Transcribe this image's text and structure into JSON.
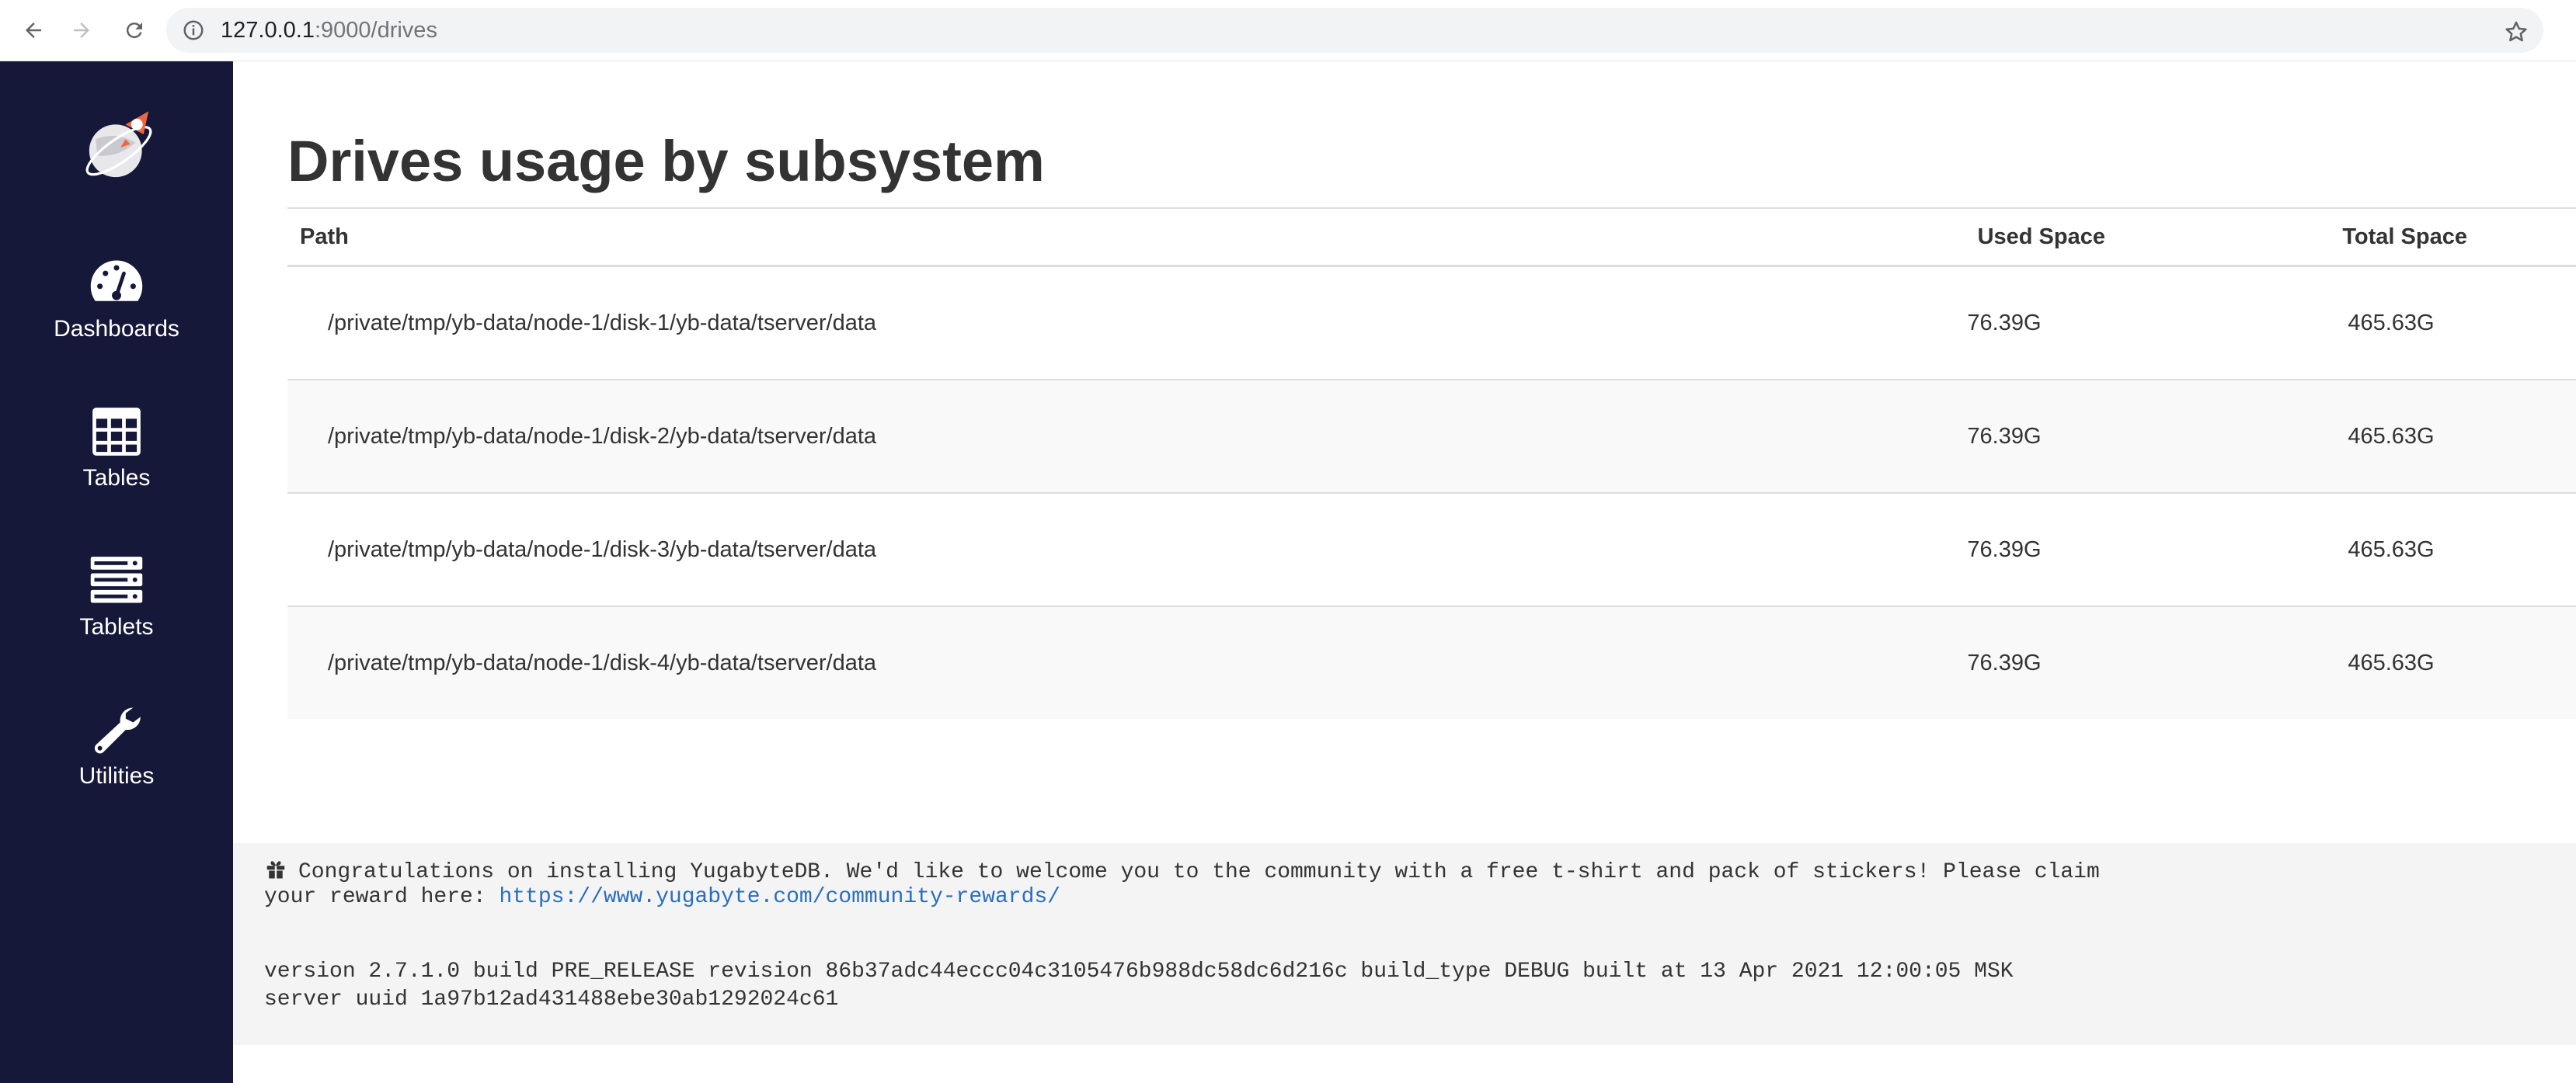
{
  "browser": {
    "url_host": "127.0.0.1",
    "url_path": ":9000/drives"
  },
  "sidebar": {
    "items": [
      {
        "label": "Dashboards",
        "icon": "dashboard-icon"
      },
      {
        "label": "Tables",
        "icon": "table-icon"
      },
      {
        "label": "Tablets",
        "icon": "server-icon"
      },
      {
        "label": "Utilities",
        "icon": "wrench-icon"
      }
    ],
    "logo_icon": "yugabyte-logo-icon",
    "background_color": "#151838"
  },
  "main": {
    "title": "Drives usage by subsystem",
    "table": {
      "headers": {
        "path": "Path",
        "used": "Used Space",
        "total": "Total Space"
      },
      "rows": [
        {
          "path": "/private/tmp/yb-data/node-1/disk-1/yb-data/tserver/data",
          "used": "76.39G",
          "total": "465.63G"
        },
        {
          "path": "/private/tmp/yb-data/node-1/disk-2/yb-data/tserver/data",
          "used": "76.39G",
          "total": "465.63G"
        },
        {
          "path": "/private/tmp/yb-data/node-1/disk-3/yb-data/tserver/data",
          "used": "76.39G",
          "total": "465.63G"
        },
        {
          "path": "/private/tmp/yb-data/node-1/disk-4/yb-data/tserver/data",
          "used": "76.39G",
          "total": "465.63G"
        }
      ]
    }
  },
  "footer": {
    "congrats_line1": "Congratulations on installing YugabyteDB. We'd like to welcome you to the community with a free t-shirt and pack of stickers! Please claim",
    "congrats_line2_prefix": "your reward here: ",
    "reward_link": "https://www.yugabyte.com/community-rewards/",
    "version_line": "version 2.7.1.0 build PRE_RELEASE revision 86b37adc44eccc04c3105476b988dc58dc6d216c build_type DEBUG built at 13 Apr 2021 12:00:05 MSK",
    "uuid_line": "server uuid 1a97b12ad431488ebe30ab1292024c61",
    "link_color": "#2a6ebb"
  }
}
